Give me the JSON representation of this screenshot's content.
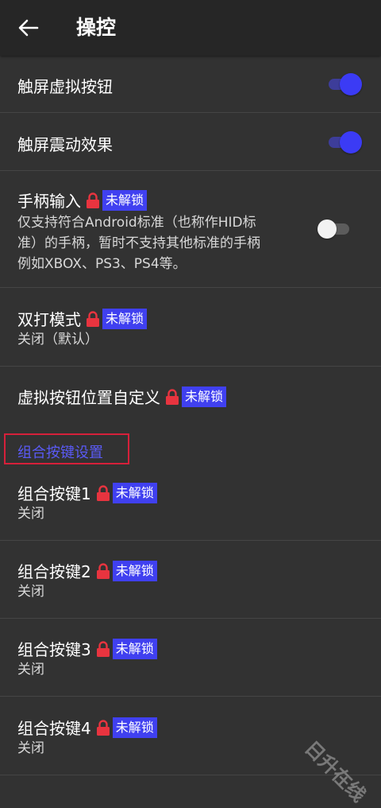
{
  "header": {
    "title": "操控",
    "back_icon": "arrow-left-icon"
  },
  "colors": {
    "accent": "#3b3bf5",
    "badge_bg": "#4040f0",
    "lock": "#e8343f",
    "section_border": "#d6203a",
    "background": "#323232",
    "topbar": "#262626"
  },
  "settings": {
    "touch_buttons": {
      "label": "触屏虚拟按钮",
      "enabled": true
    },
    "touch_vibration": {
      "label": "触屏震动效果",
      "enabled": true
    },
    "gamepad_input": {
      "label": "手柄输入",
      "badge": "未解锁",
      "description_line1": "仅支持符合Android标准（也称作HID标",
      "description_line2": "准）的手柄，暂时不支持其他标准的手柄",
      "description_line3": "例如XBOX、PS3、PS4等。",
      "enabled": false
    },
    "turbo_mode": {
      "label": "双打模式",
      "badge": "未解锁",
      "value": "关闭（默认）"
    },
    "custom_layout": {
      "label": "虚拟按钮位置自定义",
      "badge": "未解锁"
    }
  },
  "combo_section": {
    "header": "组合按键设置",
    "items": [
      {
        "label": "组合按键1",
        "badge": "未解锁",
        "value": "关闭"
      },
      {
        "label": "组合按键2",
        "badge": "未解锁",
        "value": "关闭"
      },
      {
        "label": "组合按键3",
        "badge": "未解锁",
        "value": "关闭"
      },
      {
        "label": "组合按键4",
        "badge": "未解锁",
        "value": "关闭"
      }
    ]
  },
  "watermark": "日升在线"
}
